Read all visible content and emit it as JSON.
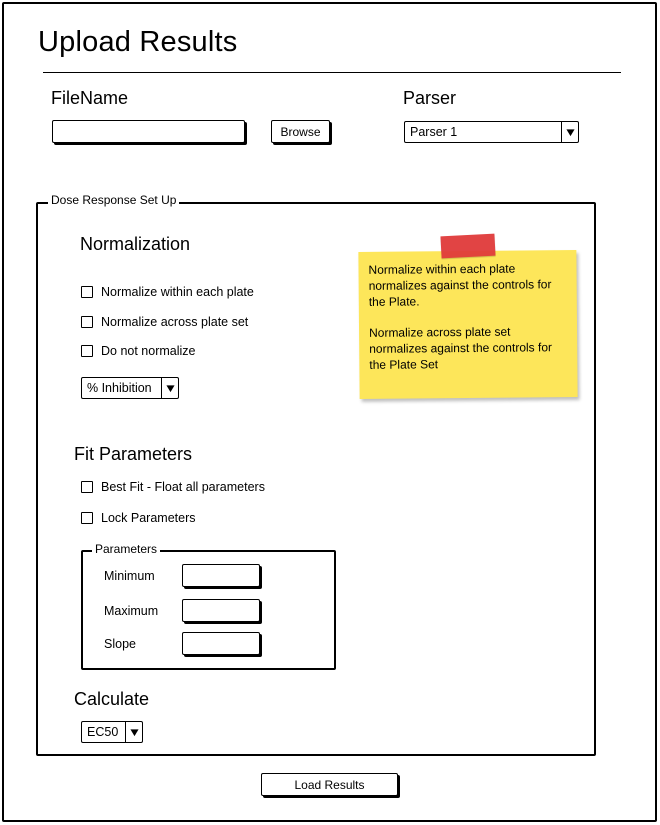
{
  "page": {
    "title": "Upload Results"
  },
  "file": {
    "label": "FileName",
    "value": "",
    "browse_label": "Browse"
  },
  "parser": {
    "label": "Parser",
    "selected": "Parser 1"
  },
  "dose_response": {
    "legend": "Dose Response Set Up",
    "normalization": {
      "heading": "Normalization",
      "options": [
        {
          "label": "Normalize within each plate",
          "checked": false
        },
        {
          "label": "Normalize across plate set",
          "checked": false
        },
        {
          "label": "Do not normalize",
          "checked": false
        }
      ],
      "mode_selected": "% Inhibition"
    },
    "note": {
      "paragraph1": "Normalize within each plate normalizes against the controls for the Plate.",
      "paragraph2": "Normalize across plate set normalizes against the controls for the Plate Set"
    },
    "fit_parameters": {
      "heading": "Fit Parameters",
      "options": [
        {
          "label": "Best Fit - Float all parameters",
          "checked": false
        },
        {
          "label": "Lock Parameters",
          "checked": false
        }
      ],
      "parameters": {
        "legend": "Parameters",
        "minimum_label": "Minimum",
        "minimum_value": "",
        "maximum_label": "Maximum",
        "maximum_value": "",
        "slope_label": "Slope",
        "slope_value": ""
      }
    },
    "calculate": {
      "heading": "Calculate",
      "selected": "EC50"
    }
  },
  "actions": {
    "load_label": "Load Results"
  },
  "colors": {
    "sticky_note": "#fde65a",
    "tape": "#e03b3b",
    "ink": "#000000"
  },
  "icons": {
    "dropdown": "triangle-down-icon"
  }
}
